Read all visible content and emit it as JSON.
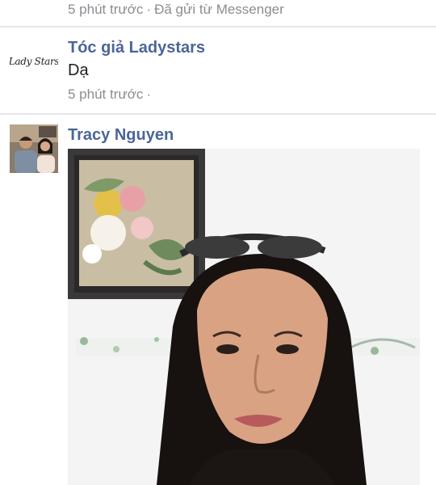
{
  "comments": [
    {
      "time": "5 phút trước",
      "separator": "·",
      "extra": "Đã gửi từ Messenger"
    },
    {
      "author": "Tóc giả Ladystars",
      "avatar_logo": "Lady Stars",
      "text": "Dạ",
      "time": "5 phút trước",
      "separator": "·"
    },
    {
      "author": "Tracy Nguyen",
      "photo_icon": "selfie-photo"
    }
  ],
  "colors": {
    "name": "#4b6598",
    "meta": "#8a8d91",
    "divider": "#e4e6eb"
  }
}
